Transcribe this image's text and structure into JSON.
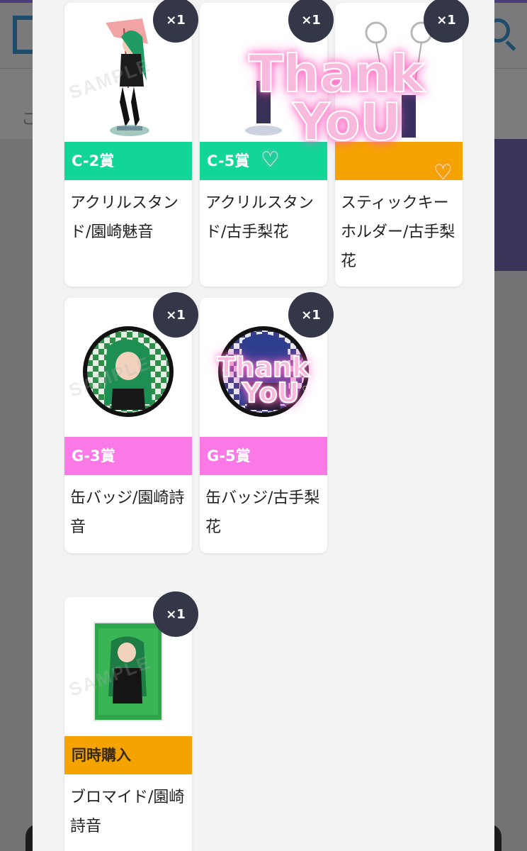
{
  "modal": {
    "items": [
      {
        "prize": "C-2賞",
        "name": "アクリルスタンド/園崎魅音",
        "qty": "×1",
        "band_color": "#12d698",
        "image": "acrylic-stand-image"
      },
      {
        "prize": "C-5賞",
        "name": "アクリルスタンド/古手梨花",
        "qty": "×1",
        "band_color": "#12d698",
        "image": "acrylic-stand-image"
      },
      {
        "prize": "",
        "name": "スティックキーホルダー/古手梨花",
        "qty": "×1",
        "band_color": "#f5a300",
        "image": "keychain-image"
      },
      {
        "prize": "G-3賞",
        "name": "缶バッジ/園崎詩音",
        "qty": "×1",
        "band_color": "#fa79e6",
        "image": "can-badge-image"
      },
      {
        "prize": "G-5賞",
        "name": "缶バッジ/古手梨花",
        "qty": "×1",
        "band_color": "#fa79e6",
        "image": "can-badge-image"
      },
      {
        "prize": "同時購入",
        "name": "ブロマイド/園崎詩音",
        "qty": "×1",
        "band_color": "#f5a300",
        "image": "bromide-image"
      }
    ]
  },
  "background": {
    "sub_text": "こ"
  },
  "overlay": {
    "thank_large_line1": "Thank",
    "thank_large_line2": "YoU",
    "thank_small_line1": "Thank",
    "thank_small_line2": "YoU"
  },
  "sample_watermark": "SAMPLE"
}
